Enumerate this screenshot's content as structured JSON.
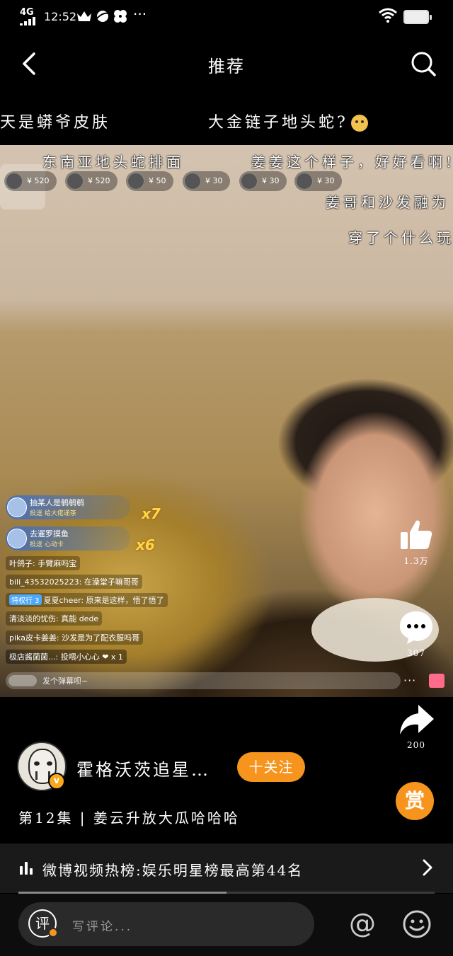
{
  "status_bar": {
    "network": "4G",
    "time": "12:52",
    "icons": [
      "crown-icon",
      "planet-icon",
      "pinwheel-icon",
      "more-dots-icon",
      "wifi-icon",
      "battery-icon"
    ],
    "more": "···"
  },
  "header": {
    "title": "推荐",
    "back_icon": "chevron-left-icon",
    "search_icon": "search-icon"
  },
  "top_danmaku": [
    "天是蟒爷皮肤",
    "大金链子地头蛇?"
  ],
  "video": {
    "danmaku": [
      "东南亚地头蛇排面",
      "姜姜这个样子，好好看啊!",
      "姜哥和沙发融为",
      "穿了个什么玩"
    ],
    "gift_ranks": [
      "¥ 520",
      "¥ 520",
      "¥ 50",
      "¥ 30",
      "¥ 30",
      "¥ 30"
    ],
    "gift_notices": [
      {
        "name": "抽某人是鹌鹌鹌",
        "gift": "投送 给大佬递茶",
        "combo": "x7"
      },
      {
        "name": "去暹罗摸鱼",
        "gift": "投送 心动卡",
        "combo": "x6"
      }
    ],
    "chat": [
      {
        "text": "叶鸽子: 手臂麻吗宝"
      },
      {
        "text": "bili_43532025223: 在澡堂子嘛哥哥"
      },
      {
        "badge": "特权行 3",
        "text": "夏夏cheer: 原来是这样，悟了悟了"
      },
      {
        "text": "清淡淡的忧伤: 真能 dede"
      },
      {
        "text": "pika皮卡姜姜: 沙发是为了配衣服吗哥"
      },
      {
        "text": "极店酱菌菌...: 投喂小心心 ❤ x 1"
      }
    ],
    "danmaku_input": "发个弹幕呗~",
    "more": "···"
  },
  "actions": {
    "like_count": "1.3万",
    "comment_count": "307",
    "share_count": "200",
    "reward_label": "赏"
  },
  "uploader": {
    "name": "霍格沃茨追星…",
    "verified_label": "v",
    "follow_label": "十关注"
  },
  "episode_title": "第12集 | 姜云升放大瓜哈哈哈",
  "hot_rank": {
    "text": "微博视频热榜:娱乐明星榜最高第44名",
    "progress": 0.5
  },
  "comment_bar": {
    "icon_label": "评",
    "placeholder": "写评论...",
    "at_label": "@"
  }
}
